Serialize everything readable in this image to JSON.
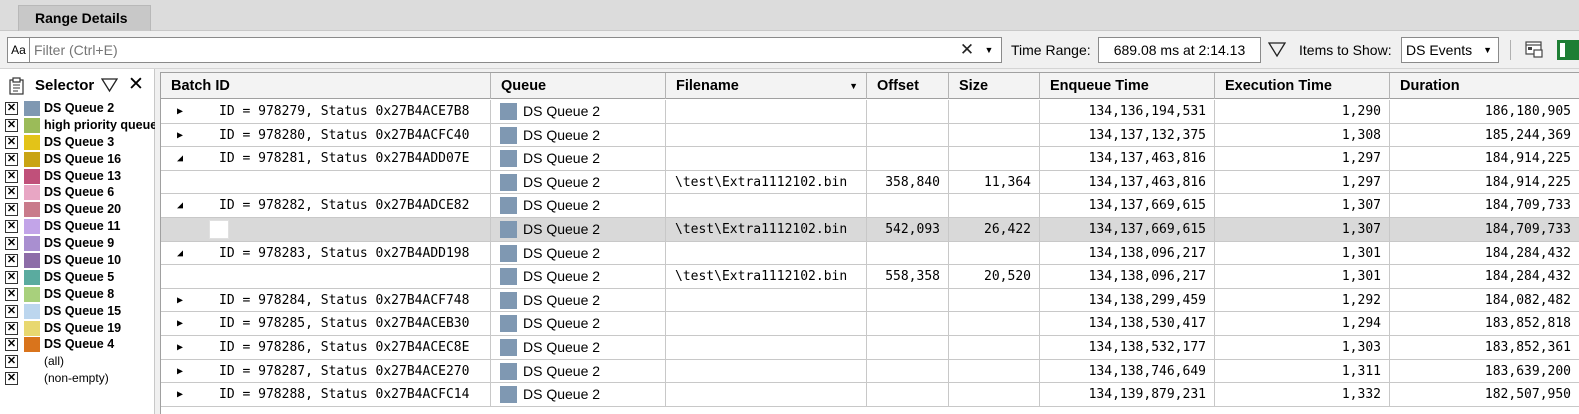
{
  "tab": {
    "label": "Range Details"
  },
  "toolbar": {
    "case_label": "Aa",
    "filter_placeholder": "Filter (Ctrl+E)",
    "clear_glyph": "✕",
    "dropdown_glyph": "▼",
    "time_range_label": "Time Range:",
    "time_range_value": "689.08 ms at 2:14.13",
    "items_label": "Items to Show:",
    "items_value": "DS Events"
  },
  "selector": {
    "title": "Selector",
    "close_glyph": "✕",
    "items": [
      {
        "label": "DS Queue 2",
        "color": "#7f98b2",
        "checked": "✕"
      },
      {
        "label": "high priority queue",
        "color": "#9bbb59",
        "checked": "✕"
      },
      {
        "label": "DS Queue 3",
        "color": "#e3c318",
        "checked": "✕"
      },
      {
        "label": "DS Queue 16",
        "color": "#c9a414",
        "checked": "✕"
      },
      {
        "label": "DS Queue 13",
        "color": "#c0507a",
        "checked": "✕"
      },
      {
        "label": "DS Queue 6",
        "color": "#e8a6c4",
        "checked": "✕"
      },
      {
        "label": "DS Queue 20",
        "color": "#c97b8b",
        "checked": "✕"
      },
      {
        "label": "DS Queue 11",
        "color": "#c2a4e8",
        "checked": "✕"
      },
      {
        "label": "DS Queue 9",
        "color": "#a98fd0",
        "checked": "✕"
      },
      {
        "label": "DS Queue 10",
        "color": "#8d6ca8",
        "checked": "✕"
      },
      {
        "label": "DS Queue 5",
        "color": "#5aab9f",
        "checked": "✕"
      },
      {
        "label": "DS Queue 8",
        "color": "#a8d07c",
        "checked": "✕"
      },
      {
        "label": "DS Queue 15",
        "color": "#bcd6ee",
        "checked": "✕"
      },
      {
        "label": "DS Queue 19",
        "color": "#e8d870",
        "checked": "✕"
      },
      {
        "label": "DS Queue 4",
        "color": "#d9741c",
        "checked": "✕"
      },
      {
        "label": "(all)",
        "color": "",
        "checked": "✕"
      },
      {
        "label": "(non-empty)",
        "color": "",
        "checked": "✕"
      }
    ]
  },
  "grid": {
    "columns": [
      "Batch ID",
      "Queue",
      "Filename",
      "Offset",
      "Size",
      "Enqueue Time",
      "Execution Time",
      "Duration"
    ],
    "rows": [
      {
        "expander": "▶",
        "batch": "ID = 978279, Status 0x27B4ACE7B8",
        "queue": "DS Queue 2",
        "filename": "",
        "offset": "",
        "size": "",
        "enqueue": "134,136,194,531",
        "execution": "1,290",
        "duration": "186,180,905"
      },
      {
        "expander": "▶",
        "batch": "ID = 978280, Status 0x27B4ACFC40",
        "queue": "DS Queue 2",
        "filename": "",
        "offset": "",
        "size": "",
        "enqueue": "134,137,132,375",
        "execution": "1,308",
        "duration": "185,244,369"
      },
      {
        "expander": "◢",
        "batch": "ID = 978281, Status 0x27B4ADD07E",
        "queue": "DS Queue 2",
        "filename": "",
        "offset": "",
        "size": "",
        "enqueue": "134,137,463,816",
        "execution": "1,297",
        "duration": "184,914,225"
      },
      {
        "expander": "",
        "batch": "",
        "queue": "DS Queue 2",
        "filename": "\\test\\Extra1112102.bin",
        "offset": "358,840",
        "size": "11,364",
        "enqueue": "134,137,463,816",
        "execution": "1,297",
        "duration": "184,914,225"
      },
      {
        "expander": "◢",
        "batch": "ID = 978282, Status 0x27B4ADCE82",
        "queue": "DS Queue 2",
        "filename": "",
        "offset": "",
        "size": "",
        "enqueue": "134,137,669,615",
        "execution": "1,307",
        "duration": "184,709,733"
      },
      {
        "expander": "",
        "batch": "",
        "queue": "DS Queue 2",
        "filename": "\\test\\Extra1112102.bin",
        "offset": "542,093",
        "size": "26,422",
        "enqueue": "134,137,669,615",
        "execution": "1,307",
        "duration": "184,709,733",
        "selected": true
      },
      {
        "expander": "◢",
        "batch": "ID = 978283, Status 0x27B4ADD198",
        "queue": "DS Queue 2",
        "filename": "",
        "offset": "",
        "size": "",
        "enqueue": "134,138,096,217",
        "execution": "1,301",
        "duration": "184,284,432"
      },
      {
        "expander": "",
        "batch": "",
        "queue": "DS Queue 2",
        "filename": "\\test\\Extra1112102.bin",
        "offset": "558,358",
        "size": "20,520",
        "enqueue": "134,138,096,217",
        "execution": "1,301",
        "duration": "184,284,432"
      },
      {
        "expander": "▶",
        "batch": "ID = 978284, Status 0x27B4ACF748",
        "queue": "DS Queue 2",
        "filename": "",
        "offset": "",
        "size": "",
        "enqueue": "134,138,299,459",
        "execution": "1,292",
        "duration": "184,082,482"
      },
      {
        "expander": "▶",
        "batch": "ID = 978285, Status 0x27B4ACEB30",
        "queue": "DS Queue 2",
        "filename": "",
        "offset": "",
        "size": "",
        "enqueue": "134,138,530,417",
        "execution": "1,294",
        "duration": "183,852,818"
      },
      {
        "expander": "▶",
        "batch": "ID = 978286, Status 0x27B4ACEC8E",
        "queue": "DS Queue 2",
        "filename": "",
        "offset": "",
        "size": "",
        "enqueue": "134,138,532,177",
        "execution": "1,303",
        "duration": "183,852,361"
      },
      {
        "expander": "▶",
        "batch": "ID = 978287, Status 0x27B4ACE270",
        "queue": "DS Queue 2",
        "filename": "",
        "offset": "",
        "size": "",
        "enqueue": "134,138,746,649",
        "execution": "1,311",
        "duration": "183,639,200"
      },
      {
        "expander": "▶",
        "batch": "ID = 978288, Status 0x27B4ACFC14",
        "queue": "DS Queue 2",
        "filename": "",
        "offset": "",
        "size": "",
        "enqueue": "134,139,879,231",
        "execution": "1,332",
        "duration": "182,507,950"
      }
    ]
  }
}
